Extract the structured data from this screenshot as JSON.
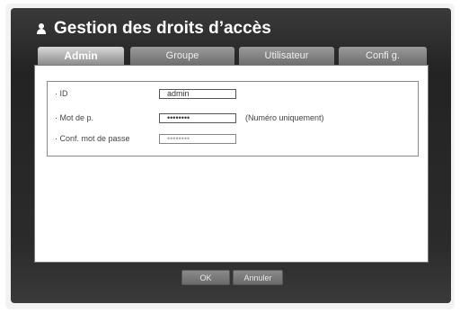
{
  "window": {
    "title": "Gestion des droits d’accès"
  },
  "tabs": [
    {
      "label": "Admin",
      "active": true
    },
    {
      "label": "Groupe",
      "active": false
    },
    {
      "label": "Utilisateur",
      "active": false
    },
    {
      "label": "Confi g.",
      "active": false
    }
  ],
  "form": {
    "id": {
      "label": "· ID",
      "value": "admin"
    },
    "password": {
      "label": "· Mot de p.",
      "value": "••••••••",
      "note": "(Numéro uniquement)"
    },
    "confirm": {
      "label": "· Conf. mot de passe",
      "value": "••••••••"
    }
  },
  "buttons": {
    "ok": "OK",
    "cancel": "Annuler"
  },
  "colors": {
    "window_bg": "#2b2b2b",
    "tab_active": "#b5b5b5",
    "tab_inactive": "#858585",
    "panel": "#ffffff"
  }
}
